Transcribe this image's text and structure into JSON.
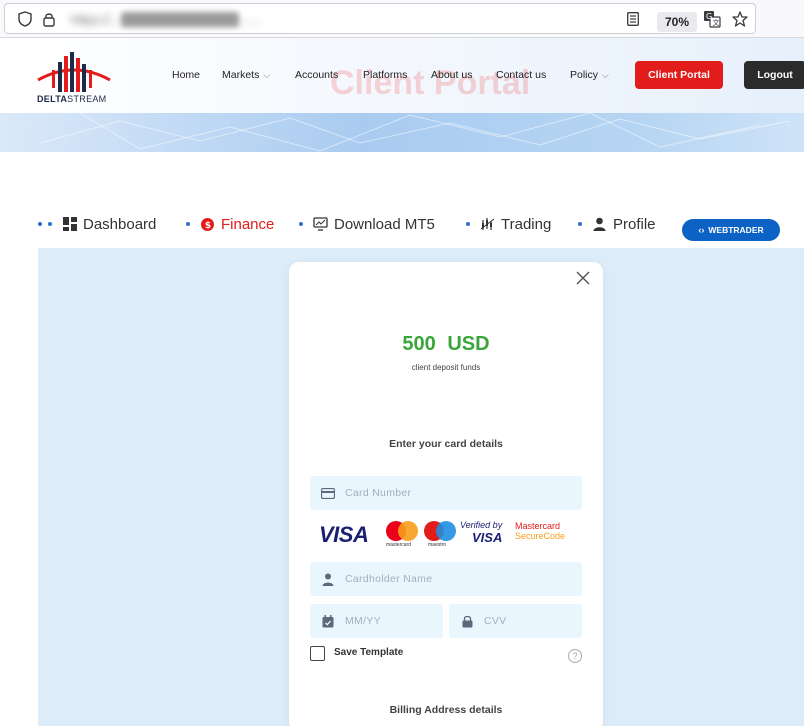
{
  "browser": {
    "zoom": "70%"
  },
  "header": {
    "logo_text_bold": "DELTA",
    "logo_text_thin": "STREAM",
    "watermark": "Client Portal",
    "nav": [
      {
        "label": "Home"
      },
      {
        "label": "Markets"
      },
      {
        "label": "Accounts"
      },
      {
        "label": "Platforms"
      },
      {
        "label": "About us"
      },
      {
        "label": "Contact us"
      },
      {
        "label": "Policy"
      }
    ],
    "client_portal_button": "Client Portal",
    "logout_button": "Logout"
  },
  "tabs": [
    {
      "label": "Dashboard",
      "icon": "grid-icon"
    },
    {
      "label": "Finance",
      "icon": "dollar-coin-icon"
    },
    {
      "label": "Download MT5",
      "icon": "monitor-icon"
    },
    {
      "label": "Trading",
      "icon": "chart-icon"
    },
    {
      "label": "Profile",
      "icon": "user-icon"
    }
  ],
  "webtrader_label": "WEBTRADER",
  "modal": {
    "amount": "500 USD",
    "amount_sub": "client deposit funds",
    "card_section_title": "Enter your card details",
    "card_number_placeholder": "Card Number",
    "cardholder_placeholder": "Cardholder Name",
    "expiry_placeholder": "MM/YY",
    "cvv_placeholder": "CVV",
    "save_template_label": "Save Template",
    "billing_title": "Billing Address details",
    "card_logos": {
      "visa": "VISA",
      "mastercard": "mastercard",
      "maestro": "maestro",
      "verified_by": "Verified by",
      "verified_visa": "VISA",
      "mc_secure_1": "Mastercard",
      "mc_secure_2": "SecureCode"
    }
  },
  "colors": {
    "accent_red": "#e21b1b",
    "amount_green": "#3aa63a",
    "webtrader_blue": "#0d63c5"
  }
}
